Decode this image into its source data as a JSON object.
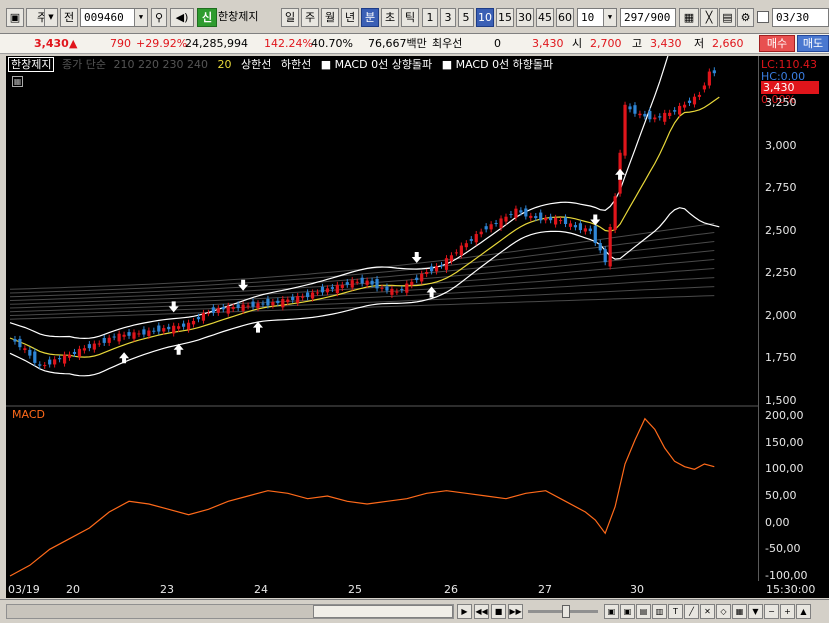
{
  "toolbar": {
    "market_label": "주",
    "prefix_label": "전",
    "code": "009460",
    "new_badge": "신",
    "stock_name": "한창제지",
    "periods": [
      "일",
      "주",
      "월",
      "년",
      "분",
      "초",
      "틱"
    ],
    "intervals": [
      "1",
      "3",
      "5",
      "10",
      "15",
      "30",
      "45",
      "60"
    ],
    "interval_select": "10",
    "count": "297",
    "count_total": "/900",
    "date_value": "03/30"
  },
  "quote": {
    "price": "3,430",
    "change": "790",
    "change_rate": "+29.92%",
    "volume": "24,285,994",
    "volume_ratio": "142.24%",
    "turnover": "40.70%",
    "amount": "76,667백만",
    "pref_label": "최우선",
    "pref_value": "0",
    "current": "3,430",
    "open_label": "시",
    "open": "2,700",
    "high_label": "고",
    "high": "3,430",
    "low_label": "저",
    "low": "2,660",
    "buy_label": "매수",
    "sell_label": "매도"
  },
  "legend": {
    "stock": "한창제지",
    "ma_label": "종가 단순",
    "ma_periods": "210  220  230  240",
    "ma20": "20",
    "band_upper": "상한선",
    "band_lower": "하한선",
    "macd_up": "MACD 0선 상향돌파",
    "macd_down": "MACD 0선 하향돌파"
  },
  "price_axis": {
    "lc": "LC:110.43",
    "hc": "HC:0.00",
    "current": "3,430",
    "pct": "0.00%",
    "ticks": [
      "3,250",
      "3,000",
      "2,750",
      "2,500",
      "2,250",
      "2,000",
      "1,750",
      "1,500"
    ],
    "macd_ticks": [
      "200,00",
      "150,00",
      "100,00",
      "50,00",
      "0,00",
      "-50,00",
      "-100,00"
    ]
  },
  "macd_label": "MACD",
  "dates": [
    "03/19",
    "20",
    "23",
    "24",
    "25",
    "26",
    "27",
    "30"
  ],
  "time_label": "15:30:00",
  "colors": {
    "up": "#e0151b",
    "down": "#2f86d6",
    "ma20": "#e8d83a",
    "band": "#ffffff",
    "macd": "#ff6a1a"
  },
  "chart_data": {
    "type": "candlestick",
    "price_ticks": [
      3250,
      3000,
      2750,
      2500,
      2250,
      2000,
      1750,
      1500
    ],
    "price_range": [
      1500,
      3350
    ],
    "macd_ticks": [
      200,
      150,
      100,
      50,
      0,
      -50,
      -100
    ],
    "macd_range": [
      -100,
      200
    ],
    "dates": [
      "03/19",
      "20",
      "23",
      "24",
      "25",
      "26",
      "27",
      "30"
    ],
    "price_path": [
      [
        0,
        1870
      ],
      [
        3,
        1800
      ],
      [
        6,
        1700
      ],
      [
        9,
        1740
      ],
      [
        12,
        1770
      ],
      [
        15,
        1810
      ],
      [
        18,
        1840
      ],
      [
        21,
        1880
      ],
      [
        24,
        1890
      ],
      [
        27,
        1900
      ],
      [
        30,
        1920
      ],
      [
        33,
        1930
      ],
      [
        36,
        1950
      ],
      [
        39,
        2010
      ],
      [
        42,
        2040
      ],
      [
        45,
        2050
      ],
      [
        48,
        2060
      ],
      [
        51,
        2070
      ],
      [
        54,
        2080
      ],
      [
        57,
        2100
      ],
      [
        60,
        2120
      ],
      [
        63,
        2150
      ],
      [
        66,
        2170
      ],
      [
        69,
        2200
      ],
      [
        72,
        2200
      ],
      [
        75,
        2160
      ],
      [
        78,
        2140
      ],
      [
        81,
        2200
      ],
      [
        84,
        2260
      ],
      [
        87,
        2300
      ],
      [
        90,
        2380
      ],
      [
        93,
        2450
      ],
      [
        96,
        2520
      ],
      [
        99,
        2560
      ],
      [
        102,
        2620
      ],
      [
        105,
        2580
      ],
      [
        108,
        2570
      ],
      [
        111,
        2560
      ],
      [
        114,
        2520
      ],
      [
        117,
        2500
      ],
      [
        120,
        2320
      ],
      [
        122,
        2700
      ],
      [
        124,
        3230
      ],
      [
        127,
        3180
      ],
      [
        130,
        3160
      ],
      [
        133,
        3190
      ],
      [
        136,
        3240
      ],
      [
        139,
        3300
      ],
      [
        141,
        3430
      ],
      [
        143,
        3430
      ]
    ],
    "macd_path": [
      [
        0,
        -100
      ],
      [
        4,
        -80
      ],
      [
        8,
        -50
      ],
      [
        12,
        -30
      ],
      [
        16,
        -10
      ],
      [
        20,
        20
      ],
      [
        24,
        40
      ],
      [
        28,
        35
      ],
      [
        32,
        25
      ],
      [
        36,
        15
      ],
      [
        40,
        25
      ],
      [
        44,
        40
      ],
      [
        48,
        50
      ],
      [
        52,
        60
      ],
      [
        56,
        55
      ],
      [
        60,
        45
      ],
      [
        64,
        50
      ],
      [
        68,
        40
      ],
      [
        72,
        35
      ],
      [
        76,
        40
      ],
      [
        80,
        45
      ],
      [
        84,
        55
      ],
      [
        88,
        60
      ],
      [
        92,
        55
      ],
      [
        96,
        50
      ],
      [
        100,
        45
      ],
      [
        104,
        55
      ],
      [
        108,
        60
      ],
      [
        112,
        40
      ],
      [
        116,
        20
      ],
      [
        118,
        5
      ],
      [
        120,
        -20
      ],
      [
        122,
        30
      ],
      [
        124,
        110
      ],
      [
        126,
        155
      ],
      [
        128,
        195
      ],
      [
        130,
        175
      ],
      [
        132,
        140
      ],
      [
        134,
        115
      ],
      [
        136,
        105
      ],
      [
        138,
        100
      ],
      [
        140,
        110
      ],
      [
        142,
        105
      ]
    ]
  }
}
